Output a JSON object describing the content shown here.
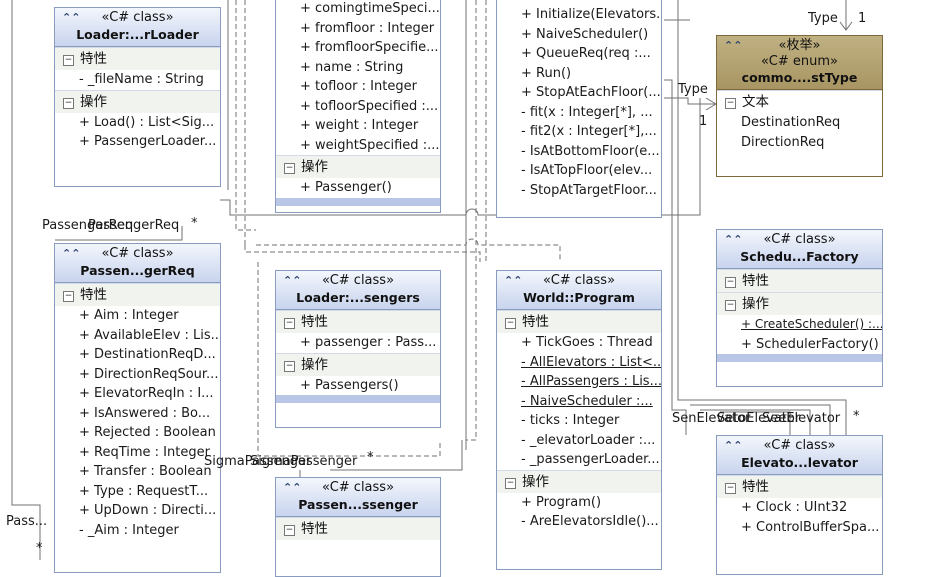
{
  "boxes": {
    "loader_reader": {
      "stereotype": "«C# class»",
      "name": "Loader:...rLoader",
      "attr_section": "特性",
      "attrs": [
        "- _fileName : String"
      ],
      "op_section": "操作",
      "ops": [
        "+ Load() : List<Sig...",
        "+ PassengerLoader..."
      ]
    },
    "passenger": {
      "attrs": [
        "+ comingtimeSpeci...",
        "+ fromfloor : Integer",
        "+ fromfloorSpecifie...",
        "+ name : String",
        "+ tofloor : Integer",
        "+ tofloorSpecified :...",
        "+ weight : Integer",
        "+ weightSpecified :..."
      ],
      "op_section": "操作",
      "ops": [
        "+ Passenger()"
      ]
    },
    "naive_scheduler": {
      "ops": [
        "+ Initialize(Elevators...",
        "+ NaiveScheduler()",
        "+ QueueReq(req :...",
        "+ Run()",
        "+ StopAtEachFloor(...",
        "- fit(x : Integer[*], ...",
        "- fit2(x : Integer[*],...",
        "- IsAtBottomFloor(e...",
        "- IsAtTopFloor(elev...",
        "- StopAtTargetFloor..."
      ]
    },
    "common_enum": {
      "stereotype1": "«枚举»",
      "stereotype2": "«C# enum»",
      "name": "commo....stType",
      "section": "文本",
      "items": [
        "DestinationReq",
        "DirectionReq"
      ]
    },
    "passenger_req": {
      "stereotype": "«C# class»",
      "name": "Passen...gerReq",
      "attr_section": "特性",
      "attrs": [
        "+ Aim : Integer",
        "+ AvailableElev : Lis...",
        "+ DestinationReqD...",
        "+ DirectionReqSour...",
        "+ ElevatorReqIn : I...",
        "+ IsAnswered : Bo...",
        "+ Rejected : Boolean",
        "+ ReqTime : Integer",
        "+ Transfer : Boolean",
        "+ Type : RequestT...",
        "+ UpDown : Directi...",
        "- _Aim : Integer"
      ]
    },
    "loader_passengers": {
      "stereotype": "«C# class»",
      "name": "Loader:...sengers",
      "attr_section": "特性",
      "attrs": [
        "+ passenger : Pass..."
      ],
      "op_section": "操作",
      "ops": [
        "+ Passengers()"
      ]
    },
    "world_program": {
      "stereotype": "«C# class»",
      "name": "World::Program",
      "attr_section": "特性",
      "attrs": [
        {
          "text": "+ TickGoes : Thread",
          "underline": false
        },
        {
          "text": "- AllElevators : List<...",
          "underline": true
        },
        {
          "text": "- AllPassengers : Lis...",
          "underline": true
        },
        {
          "text": "- NaiveScheduler :...",
          "underline": true
        },
        {
          "text": "- ticks : Integer",
          "underline": false
        },
        {
          "text": "- _elevatorLoader :...",
          "underline": false
        },
        {
          "text": "- _passengerLoader...",
          "underline": false
        }
      ],
      "op_section": "操作",
      "ops": [
        "+ Program()",
        "- AreElevatorsIdle()..."
      ]
    },
    "scheduler_factory": {
      "stereotype": "«C# class»",
      "name": "Schedu...Factory",
      "attr_section": "特性",
      "op_section": "操作",
      "ops": [
        {
          "text": "+ CreateScheduler() :...",
          "underline": true
        },
        {
          "text": "+ SchedulerFactory()",
          "underline": false
        }
      ]
    },
    "passenger_loader": {
      "stereotype": "«C# class»",
      "name": "Passen...ssenger",
      "attr_section": "特性"
    },
    "elevator": {
      "stereotype": "«C# class»",
      "name": "Elevato...levator",
      "attr_section": "特性",
      "attrs": [
        "+ Clock : UInt32",
        "+ ControlBufferSpa..."
      ]
    }
  },
  "labels": {
    "type_top": "Type",
    "one_top": "1",
    "type_mid": "Type",
    "one_mid": "1",
    "passenger_req_a": "PassengerReq",
    "passenger_req_b": "PassengerReq",
    "star_req": "*",
    "sigma_a": "SigmaPassenger",
    "sigma_b": "SigmaPassenger",
    "star_sigma": "*",
    "sen_a": "SenElevator",
    "sen_b": "SetoElevator",
    "sen_c": "SeeElevator",
    "star_sen": "*",
    "pass_left": "Pass...",
    "star_left": "*"
  }
}
